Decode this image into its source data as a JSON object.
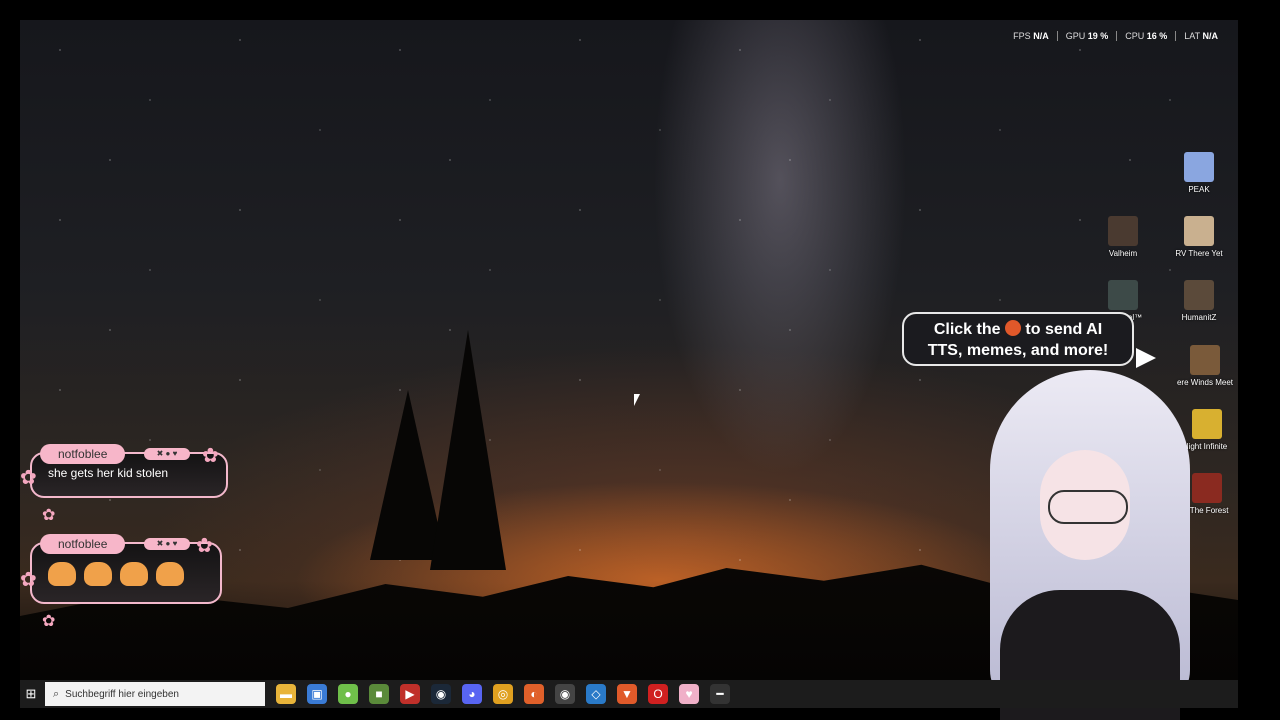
{
  "stats": [
    {
      "label": "FPS",
      "value": "N/A"
    },
    {
      "label": "GPU",
      "value": "19 %"
    },
    {
      "label": "CPU",
      "value": "16 %"
    },
    {
      "label": "LAT",
      "value": "N/A"
    }
  ],
  "desktop_icons": [
    {
      "label": "PEAK",
      "color": "#8aa6e0"
    },
    {
      "label": "Valheim",
      "color": "#4a3a30"
    },
    {
      "label": "RV There Yet",
      "color": "#c9b08f"
    },
    {
      "label": "Returnal™",
      "color": "#3d4a48"
    },
    {
      "label": "HumanitZ",
      "color": "#5b4a3a"
    },
    {
      "label": "ere Winds Meet",
      "color": "#7a5a3a"
    },
    {
      "label": "light Infinite",
      "color": "#d8b030"
    },
    {
      "label": "f The Forest",
      "color": "#8a2a20"
    }
  ],
  "tooltip": {
    "line1_pre": "Click the",
    "line1_post": "to send AI",
    "line2": "TTS, memes, and more!"
  },
  "chat": [
    {
      "user": "notfoblee",
      "badges": "✖ ● ♥",
      "message": "she gets her kid stolen"
    },
    {
      "user": "notfoblee",
      "badges": "✖ ● ♥",
      "message": ""
    }
  ],
  "taskbar": {
    "search_placeholder": "Suchbegriff hier eingeben",
    "apps": [
      {
        "name": "file-explorer",
        "color": "#e8b43a",
        "glyph": "▬"
      },
      {
        "name": "microsoft-store",
        "color": "#3a7bd5",
        "glyph": "▣"
      },
      {
        "name": "android-app",
        "color": "#6fbf4a",
        "glyph": "●"
      },
      {
        "name": "minecraft",
        "color": "#5a8a3a",
        "glyph": "■"
      },
      {
        "name": "media-app",
        "color": "#c0302a",
        "glyph": "▶"
      },
      {
        "name": "steam",
        "color": "#1b2838",
        "glyph": "◉"
      },
      {
        "name": "discord",
        "color": "#5865f2",
        "glyph": "◕"
      },
      {
        "name": "chrome",
        "color": "#e0a020",
        "glyph": "◎"
      },
      {
        "name": "firefox",
        "color": "#e0602a",
        "glyph": "◐"
      },
      {
        "name": "obs",
        "color": "#444",
        "glyph": "◉"
      },
      {
        "name": "app-blue",
        "color": "#2a7ac8",
        "glyph": "◇"
      },
      {
        "name": "brave",
        "color": "#e05a2a",
        "glyph": "▼"
      },
      {
        "name": "opera",
        "color": "#d02020",
        "glyph": "O"
      },
      {
        "name": "pink-app",
        "color": "#f0b0c8",
        "glyph": "♥"
      },
      {
        "name": "tool-app",
        "color": "#333",
        "glyph": "━"
      }
    ]
  }
}
